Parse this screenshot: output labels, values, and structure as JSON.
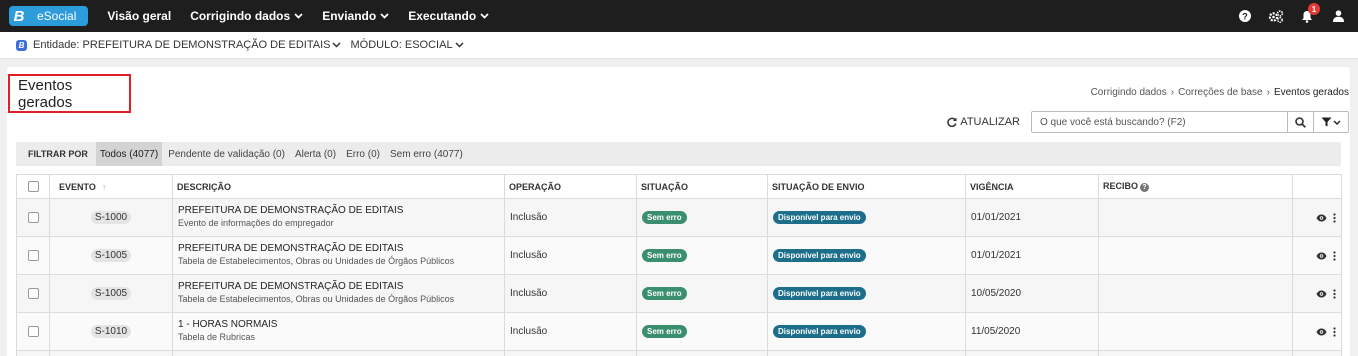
{
  "topnav": {
    "logo_letter": "B",
    "app_name": "eSocial",
    "items": [
      {
        "label": "Visão geral",
        "has_dropdown": false
      },
      {
        "label": "Corrigindo dados",
        "has_dropdown": true
      },
      {
        "label": "Enviando",
        "has_dropdown": true
      },
      {
        "label": "Executando",
        "has_dropdown": true
      }
    ],
    "notification_count": "1",
    "colors": {
      "bar": "#1e1e1e",
      "brand": "#2d9cdb",
      "badge": "#e53935"
    }
  },
  "subbar": {
    "entity_label": "Entidade: PREFEITURA DE DEMONSTRAÇÃO DE EDITAIS",
    "module_label": "MÓDULO: ESOCIAL"
  },
  "page": {
    "title": "Eventos gerados",
    "breadcrumb": [
      "Corrigindo dados",
      "Correções de base",
      "Eventos gerados"
    ]
  },
  "toolbar": {
    "refresh_label": "ATUALIZAR",
    "search_placeholder": "O que você está buscando? (F2)"
  },
  "filters": {
    "label": "FILTRAR POR",
    "chips": [
      {
        "label": "Todos (4077)",
        "active": true
      },
      {
        "label": "Pendente de validação (0)",
        "active": false
      },
      {
        "label": "Alerta (0)",
        "active": false
      },
      {
        "label": "Erro (0)",
        "active": false
      },
      {
        "label": "Sem erro (4077)",
        "active": false
      }
    ]
  },
  "table": {
    "headers": {
      "evento": "EVENTO",
      "descricao": "DESCRIÇÃO",
      "operacao": "OPERAÇÃO",
      "situacao": "SITUAÇÃO",
      "situacao_envio": "SITUAÇÃO DE ENVIO",
      "vigencia": "VIGÊNCIA",
      "recibo": "RECIBO"
    },
    "rows": [
      {
        "evento": "S-1000",
        "descricao": "PREFEITURA DE DEMONSTRAÇÃO DE EDITAIS",
        "descricao_sub": "Evento de informações do empregador",
        "operacao": "Inclusão",
        "situacao": "Sem erro",
        "situacao_envio": "Disponível para envio",
        "vigencia": "01/01/2021",
        "recibo": ""
      },
      {
        "evento": "S-1005",
        "descricao": "PREFEITURA DE DEMONSTRAÇÃO DE EDITAIS",
        "descricao_sub": "Tabela de Estabelecimentos, Obras ou Unidades de Órgãos Públicos",
        "operacao": "Inclusão",
        "situacao": "Sem erro",
        "situacao_envio": "Disponível para envio",
        "vigencia": "01/01/2021",
        "recibo": ""
      },
      {
        "evento": "S-1005",
        "descricao": "PREFEITURA DE DEMONSTRAÇÃO DE EDITAIS",
        "descricao_sub": "Tabela de Estabelecimentos, Obras ou Unidades de Órgãos Públicos",
        "operacao": "Inclusão",
        "situacao": "Sem erro",
        "situacao_envio": "Disponível para envio",
        "vigencia": "10/05/2020",
        "recibo": ""
      },
      {
        "evento": "S-1010",
        "descricao": "1 - HORAS NORMAIS",
        "descricao_sub": "Tabela de Rubricas",
        "operacao": "Inclusão",
        "situacao": "Sem erro",
        "situacao_envio": "Disponível para envio",
        "vigencia": "11/05/2020",
        "recibo": ""
      }
    ],
    "colors": {
      "sem_erro": "#3a8f6e",
      "disponivel": "#1c6e8a"
    }
  }
}
